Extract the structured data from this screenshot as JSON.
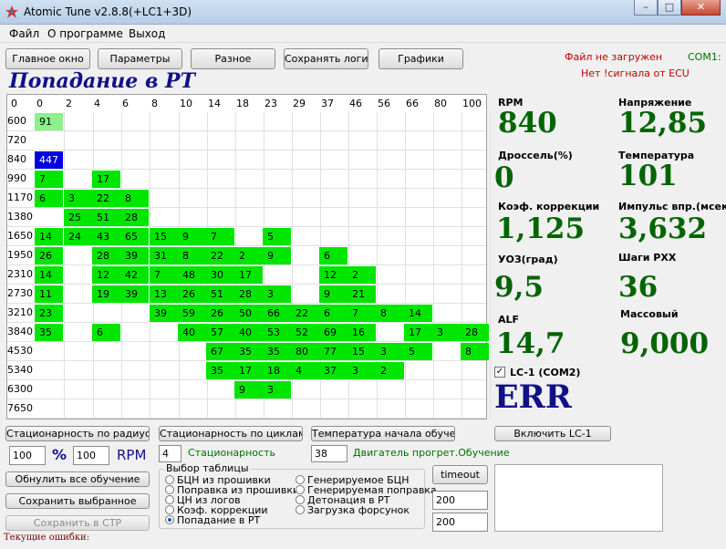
{
  "window": {
    "title": "Atomic Tune  v2.8.8(+LC1+3D)",
    "min": "–",
    "max": "□",
    "close": "✕"
  },
  "menu": [
    "Файл",
    "О программе",
    "Выход"
  ],
  "toolbar": [
    "Главное окно",
    "Параметры",
    "Разное",
    "Сохранять логи",
    "Графики"
  ],
  "status": {
    "file": "Файл не загружен",
    "port": "COM1:",
    "ecu": "Нет !сигнала от ECU"
  },
  "page_title": "Попадание в РТ",
  "colors": {
    "green": "#00e600",
    "light_green": "#8cf08c",
    "selected": "#0000e0",
    "value": "#006400",
    "title": "#10108a"
  },
  "table": {
    "columns": [
      "0",
      "0",
      "2",
      "4",
      "6",
      "8",
      "10",
      "14",
      "18",
      "23",
      "29",
      "37",
      "46",
      "56",
      "66",
      "80",
      "100"
    ],
    "rows": [
      "600",
      "720",
      "840",
      "990",
      "1170",
      "1380",
      "1650",
      "1950",
      "2310",
      "2730",
      "3210",
      "3840",
      "4530",
      "5340",
      "6300",
      "7650"
    ],
    "cells": [
      {
        "r": 0,
        "c": 0,
        "v": "91",
        "s": "light"
      },
      {
        "r": 2,
        "c": 0,
        "v": "447",
        "s": "sel"
      },
      {
        "r": 3,
        "c": 0,
        "v": "7"
      },
      {
        "r": 3,
        "c": 2,
        "v": "17"
      },
      {
        "r": 4,
        "c": 0,
        "v": "6"
      },
      {
        "r": 4,
        "c": 1,
        "v": "3"
      },
      {
        "r": 4,
        "c": 2,
        "v": "22"
      },
      {
        "r": 4,
        "c": 3,
        "v": "8"
      },
      {
        "r": 5,
        "c": 1,
        "v": "25"
      },
      {
        "r": 5,
        "c": 2,
        "v": "51"
      },
      {
        "r": 5,
        "c": 3,
        "v": "28"
      },
      {
        "r": 6,
        "c": 0,
        "v": "14"
      },
      {
        "r": 6,
        "c": 1,
        "v": "24"
      },
      {
        "r": 6,
        "c": 2,
        "v": "43"
      },
      {
        "r": 6,
        "c": 3,
        "v": "65"
      },
      {
        "r": 6,
        "c": 4,
        "v": "15"
      },
      {
        "r": 6,
        "c": 5,
        "v": "9"
      },
      {
        "r": 6,
        "c": 6,
        "v": "7"
      },
      {
        "r": 6,
        "c": 8,
        "v": "5"
      },
      {
        "r": 7,
        "c": 0,
        "v": "26"
      },
      {
        "r": 7,
        "c": 2,
        "v": "28"
      },
      {
        "r": 7,
        "c": 3,
        "v": "39"
      },
      {
        "r": 7,
        "c": 4,
        "v": "31"
      },
      {
        "r": 7,
        "c": 5,
        "v": "8"
      },
      {
        "r": 7,
        "c": 6,
        "v": "22"
      },
      {
        "r": 7,
        "c": 7,
        "v": "2"
      },
      {
        "r": 7,
        "c": 8,
        "v": "9"
      },
      {
        "r": 7,
        "c": 10,
        "v": "6"
      },
      {
        "r": 8,
        "c": 0,
        "v": "14"
      },
      {
        "r": 8,
        "c": 2,
        "v": "12"
      },
      {
        "r": 8,
        "c": 3,
        "v": "42"
      },
      {
        "r": 8,
        "c": 4,
        "v": "7"
      },
      {
        "r": 8,
        "c": 5,
        "v": "48"
      },
      {
        "r": 8,
        "c": 6,
        "v": "30"
      },
      {
        "r": 8,
        "c": 7,
        "v": "17"
      },
      {
        "r": 8,
        "c": 10,
        "v": "12"
      },
      {
        "r": 8,
        "c": 11,
        "v": "2"
      },
      {
        "r": 9,
        "c": 0,
        "v": "11"
      },
      {
        "r": 9,
        "c": 2,
        "v": "19"
      },
      {
        "r": 9,
        "c": 3,
        "v": "39"
      },
      {
        "r": 9,
        "c": 4,
        "v": "13"
      },
      {
        "r": 9,
        "c": 5,
        "v": "26"
      },
      {
        "r": 9,
        "c": 6,
        "v": "51"
      },
      {
        "r": 9,
        "c": 7,
        "v": "28"
      },
      {
        "r": 9,
        "c": 8,
        "v": "3"
      },
      {
        "r": 9,
        "c": 10,
        "v": "9"
      },
      {
        "r": 9,
        "c": 11,
        "v": "21"
      },
      {
        "r": 10,
        "c": 0,
        "v": "23"
      },
      {
        "r": 10,
        "c": 4,
        "v": "39"
      },
      {
        "r": 10,
        "c": 5,
        "v": "59"
      },
      {
        "r": 10,
        "c": 6,
        "v": "26"
      },
      {
        "r": 10,
        "c": 7,
        "v": "50"
      },
      {
        "r": 10,
        "c": 8,
        "v": "66"
      },
      {
        "r": 10,
        "c": 9,
        "v": "22"
      },
      {
        "r": 10,
        "c": 10,
        "v": "6"
      },
      {
        "r": 10,
        "c": 11,
        "v": "7"
      },
      {
        "r": 10,
        "c": 12,
        "v": "8"
      },
      {
        "r": 10,
        "c": 13,
        "v": "14"
      },
      {
        "r": 11,
        "c": 0,
        "v": "35"
      },
      {
        "r": 11,
        "c": 2,
        "v": "6"
      },
      {
        "r": 11,
        "c": 5,
        "v": "40"
      },
      {
        "r": 11,
        "c": 6,
        "v": "57"
      },
      {
        "r": 11,
        "c": 7,
        "v": "40"
      },
      {
        "r": 11,
        "c": 8,
        "v": "53"
      },
      {
        "r": 11,
        "c": 9,
        "v": "52"
      },
      {
        "r": 11,
        "c": 10,
        "v": "69"
      },
      {
        "r": 11,
        "c": 11,
        "v": "16"
      },
      {
        "r": 11,
        "c": 13,
        "v": "17"
      },
      {
        "r": 11,
        "c": 14,
        "v": "3"
      },
      {
        "r": 11,
        "c": 15,
        "v": "28"
      },
      {
        "r": 12,
        "c": 6,
        "v": "67"
      },
      {
        "r": 12,
        "c": 7,
        "v": "35"
      },
      {
        "r": 12,
        "c": 8,
        "v": "35"
      },
      {
        "r": 12,
        "c": 9,
        "v": "80"
      },
      {
        "r": 12,
        "c": 10,
        "v": "77"
      },
      {
        "r": 12,
        "c": 11,
        "v": "15"
      },
      {
        "r": 12,
        "c": 12,
        "v": "3"
      },
      {
        "r": 12,
        "c": 13,
        "v": "5"
      },
      {
        "r": 12,
        "c": 15,
        "v": "8"
      },
      {
        "r": 13,
        "c": 6,
        "v": "35"
      },
      {
        "r": 13,
        "c": 7,
        "v": "17"
      },
      {
        "r": 13,
        "c": 8,
        "v": "18"
      },
      {
        "r": 13,
        "c": 9,
        "v": "4"
      },
      {
        "r": 13,
        "c": 10,
        "v": "37"
      },
      {
        "r": 13,
        "c": 11,
        "v": "3"
      },
      {
        "r": 13,
        "c": 12,
        "v": "2"
      },
      {
        "r": 14,
        "c": 7,
        "v": "9"
      },
      {
        "r": 14,
        "c": 8,
        "v": "3"
      }
    ]
  },
  "sensors": [
    {
      "label": "RPM",
      "value": "840"
    },
    {
      "label": "Напряжение",
      "value": "12,85"
    },
    {
      "label": "Дроссель(%)",
      "value": "0"
    },
    {
      "label": "Температура",
      "value": "101"
    },
    {
      "label": "Коэф. коррекции",
      "value": "1,125"
    },
    {
      "label": "Импульс впр.(мсек)",
      "value": "3,632"
    },
    {
      "label": "УОЗ(град)",
      "value": "9,5"
    },
    {
      "label": "Шаги РХХ",
      "value": "36"
    },
    {
      "label": "ALF",
      "value": "14,7"
    },
    {
      "label": "Массовый",
      "value": "9,000"
    }
  ],
  "lc1": {
    "label": "LC-1 (COM2)",
    "value": "ERR",
    "checked": true
  },
  "bottom": {
    "btn_radius": "Стационарность по радиусам",
    "btn_cycles": "Стационарность по циклам",
    "btn_temp": "Температура начала обучения",
    "btn_lc1": "Включить LC-1",
    "val1": "100",
    "pct": "%",
    "val2": "100",
    "rpm": "RPM",
    "stat_val": "4",
    "stat_label": "Стационарность",
    "temp_val": "38",
    "engine_label": "Двигатель прогрет.Обучение",
    "btn_reset": "Обнулить все обучение",
    "btn_save_sel": "Сохранить выбранное",
    "btn_save_ctr": "Сохранить в СТР",
    "group_title": "Выбор таблицы",
    "radios_left": [
      "БЦН из прошивки",
      "Поправка из прошивки",
      "ЦН из логов",
      "Коэф. коррекции",
      "Попадание в РТ"
    ],
    "radios_right": [
      "Генерируемое БЦН",
      "Генерируемая поправка",
      "Детонация в РТ",
      "Загрузка форсунок"
    ],
    "btn_timeout": "timeout",
    "timeout1": "200",
    "timeout2": "200",
    "errors": "Текущие ошибки:"
  }
}
